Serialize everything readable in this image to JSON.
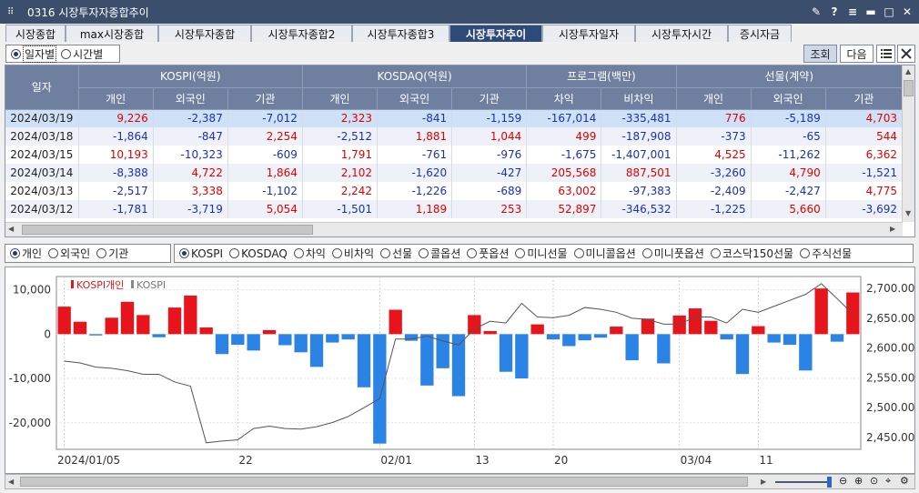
{
  "window": {
    "title": "0316 시장투자자종합추이",
    "controls": [
      "pin-icon",
      "help-icon",
      "menu-icon",
      "minimize-icon",
      "maximize-icon",
      "close-icon"
    ]
  },
  "tabs": [
    "시장종합",
    "max시장종합",
    "시장투자종합",
    "시장투자종합2",
    "시장투자종합3",
    "시장투자추이",
    "시장투자일자",
    "시장투자시간",
    "증시자금"
  ],
  "active_tab": "시장투자추이",
  "period_options": {
    "daily": "일자별",
    "hourly": "시간별",
    "selected": "일자별"
  },
  "buttons": {
    "query": "조회",
    "next": "다음"
  },
  "table": {
    "date_header": "일자",
    "groups": [
      "KOSPI(억원)",
      "KOSDAQ(억원)",
      "프로그램(백만)",
      "선물(계약)"
    ],
    "subheaders": [
      "개인",
      "외국인",
      "기관",
      "개인",
      "외국인",
      "기관",
      "차익",
      "비차익",
      "개인",
      "외국인",
      "기관"
    ],
    "rows": [
      {
        "date": "2024/03/19",
        "values": [
          "9,226",
          "-2,387",
          "-7,012",
          "2,323",
          "-841",
          "-1,159",
          "-167,014",
          "-335,481",
          "776",
          "-5,189",
          "4,703"
        ]
      },
      {
        "date": "2024/03/18",
        "values": [
          "-1,864",
          "-847",
          "2,254",
          "-2,512",
          "1,881",
          "1,044",
          "499",
          "-187,908",
          "-373",
          "-65",
          "544"
        ]
      },
      {
        "date": "2024/03/15",
        "values": [
          "10,193",
          "-10,323",
          "-609",
          "1,791",
          "-761",
          "-976",
          "-1,675",
          "-1,407,001",
          "4,525",
          "-11,262",
          "6,362"
        ]
      },
      {
        "date": "2024/03/14",
        "values": [
          "-8,388",
          "4,722",
          "1,864",
          "2,102",
          "-1,620",
          "-427",
          "205,568",
          "887,501",
          "-3,260",
          "4,790",
          "-1,521"
        ]
      },
      {
        "date": "2024/03/13",
        "values": [
          "-2,517",
          "3,338",
          "-1,102",
          "2,242",
          "-1,226",
          "-689",
          "63,002",
          "-97,383",
          "-2,409",
          "-2,427",
          "4,775"
        ]
      },
      {
        "date": "2024/03/12",
        "values": [
          "-1,781",
          "-3,719",
          "5,054",
          "-1,501",
          "1,189",
          "253",
          "52,897",
          "-346,532",
          "-1,225",
          "5,660",
          "-3,692"
        ]
      }
    ]
  },
  "investor_options": {
    "items": [
      "개인",
      "외국인",
      "기관"
    ],
    "selected": "개인"
  },
  "market_options": {
    "items": [
      "KOSPI",
      "KOSDAQ",
      "차익",
      "비차익",
      "선물",
      "콜옵션",
      "풋옵션",
      "미니선물",
      "미니콜옵션",
      "미니풋옵션",
      "코스닥150선물",
      "주식선물"
    ],
    "selected": "KOSPI"
  },
  "chart_data": {
    "type": "bar",
    "legend": [
      "KOSPI개인",
      "KOSPI"
    ],
    "colors": {
      "positive": "#e8141b",
      "negative": "#2b83e6",
      "line": "#555555"
    },
    "left_axis": {
      "ticks": [
        10000,
        0,
        -10000,
        -20000
      ],
      "tick_labels": [
        "10,000",
        "0",
        "-10,000",
        "-20,000"
      ],
      "ylim": [
        -26000,
        13000
      ]
    },
    "right_axis": {
      "ticks": [
        2700,
        2650,
        2600,
        2550,
        2500,
        2450
      ],
      "tick_labels": [
        "2,700.00",
        "2,650.00",
        "2,600.00",
        "2,550.00",
        "2,500.00",
        "2,450.00"
      ],
      "ylim": [
        2430,
        2720
      ]
    },
    "x_labels": [
      "2024/01/05",
      "22",
      "02/01",
      "13",
      "20",
      "03/04",
      "11"
    ],
    "x_label_index": [
      0,
      11,
      20,
      26,
      31,
      39,
      44
    ],
    "series": [
      {
        "name": "KOSPI개인",
        "values": [
          6200,
          2800,
          -300,
          3700,
          7300,
          4300,
          -700,
          6000,
          8700,
          1500,
          -4500,
          -2400,
          -3700,
          900,
          -2500,
          -4100,
          -7400,
          -1900,
          -1200,
          -12000,
          -24700,
          5500,
          -1500,
          -11600,
          -7700,
          -14000,
          4300,
          700,
          -8500,
          -10000,
          2200,
          -1200,
          -2700,
          -1400,
          -800,
          1700,
          -5900,
          3500,
          -6600,
          4200,
          5800,
          3000,
          -1200,
          -9000,
          1800,
          -1900,
          -2400,
          -8200,
          10300,
          -1700,
          9400
        ]
      },
      {
        "name": "KOSPI",
        "values": [
          2578,
          2575,
          2568,
          2566,
          2562,
          2556,
          2556,
          2543,
          2536,
          2441,
          2444,
          2446,
          2465,
          2469,
          2465,
          2464,
          2468,
          2475,
          2485,
          2500,
          2515,
          2615,
          2615,
          2620,
          2612,
          2605,
          2632,
          2645,
          2642,
          2675,
          2652,
          2651,
          2655,
          2668,
          2665,
          2660,
          2650,
          2648,
          2640,
          2640,
          2652,
          2652,
          2642,
          2665,
          2660,
          2670,
          2680,
          2690,
          2708,
          2683,
          2657
        ]
      }
    ]
  }
}
